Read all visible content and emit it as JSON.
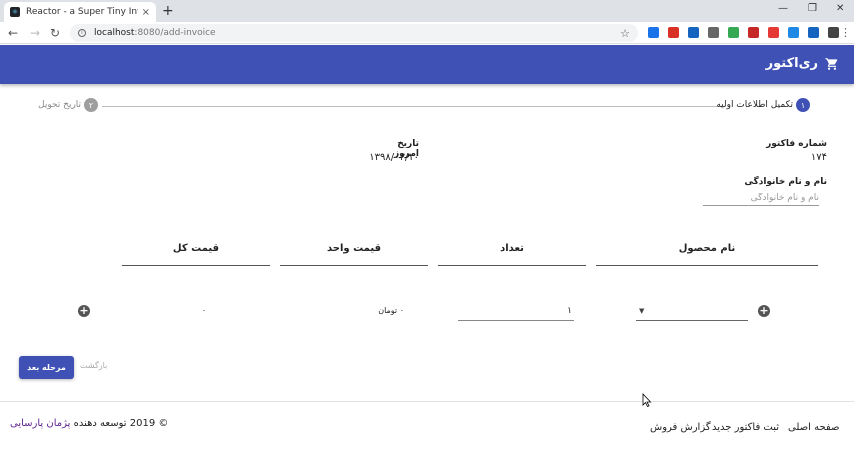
{
  "browser": {
    "tab_title": "Reactor - a Super Tiny Invoice M",
    "tab_close": "×",
    "new_tab": "+",
    "url_host": "localhost",
    "url_path": ":8080/add-invoice",
    "win_min": "—",
    "win_max": "❐",
    "win_close": "✕",
    "extension_colors": [
      "#1a73e8",
      "#d93025",
      "#1565c0",
      "#666666",
      "#34a853",
      "#c62828",
      "#e53935",
      "#1e88e5",
      "#1565c0",
      "#444444"
    ]
  },
  "app": {
    "brand": "ری‌اکتور",
    "accent": "#3f51b5"
  },
  "stepper": {
    "step1_number": "۱",
    "step1_label": "تکمیل اطلاعات اولیه",
    "step2_number": "۲",
    "step2_label": "تاریخ تحویل"
  },
  "form": {
    "invoice_number_label": "شماره فاکتور",
    "invoice_number_value": "۱۷۴",
    "today_label": "تاریخ امروز",
    "today_value": "۱۳۹۸/۰۳/۱۰",
    "name_label": "نام و نام خانوادگی",
    "name_placeholder": "نام و نام خانوادگی"
  },
  "table": {
    "headers": [
      "نام محصول",
      "تعداد",
      "قیمت واحد",
      "قیمت کل"
    ],
    "row": {
      "quantity": "۱",
      "unit_price": "۰ تومان",
      "total_price": "۰"
    }
  },
  "actions": {
    "next_label": "مرحله بعد",
    "back_label": "بازگشت"
  },
  "footer": {
    "links": [
      "صفحه اصلی",
      "ثبت فاکتور جدید",
      "گزارش فروش"
    ],
    "copyright_prefix": "© 2019 توسعه دهنده",
    "author": "پژمان پارسایی"
  }
}
